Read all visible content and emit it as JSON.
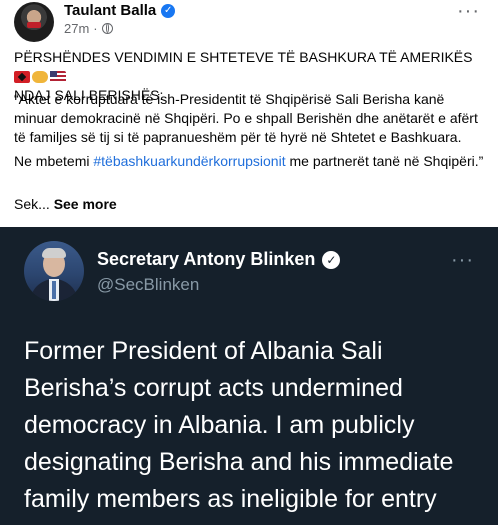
{
  "post": {
    "author": "Taulant Balla",
    "verified_mark": "✓",
    "time": "27m",
    "more_label": "···",
    "p1": "PËRSHËNDES VENDIMIN E SHTETEVE TË BASHKURA TË AMERIKËS",
    "p1_tail": "NDAJ SALI BERISHËS:",
    "p2": "“Aktet e korruptuara të ish-Presidentit të Shqipërisë Sali Berisha kanë minuar demokracinë në Shqipëri. Po e shpall Berishën dhe anëtarët e afërt të familjes së tij si të papranueshëm për të hyrë në Shtetet e Bashkuara.",
    "p3_before": "Ne mbetemi ",
    "p3_hashtag": "#tëbashkuarkundërkorrupsionit",
    "p3_after": " me partnerët tanë në Shqipëri.”",
    "p4_prefix": "Sek... ",
    "see_more": "See more",
    "icons": [
      "albania-flag-icon",
      "handshake-icon",
      "us-flag-icon",
      "globe-icon"
    ]
  },
  "tweet": {
    "name": "Secretary Antony Blinken",
    "verified_mark": "✓",
    "handle": "@SecBlinken",
    "more_label": "···",
    "body": "Former President of Albania Sali Berisha’s corrupt acts undermined democracy in Albania. I am publicly designating Berisha and his immediate family members as ineligible for entry",
    "background": "#15202b"
  }
}
